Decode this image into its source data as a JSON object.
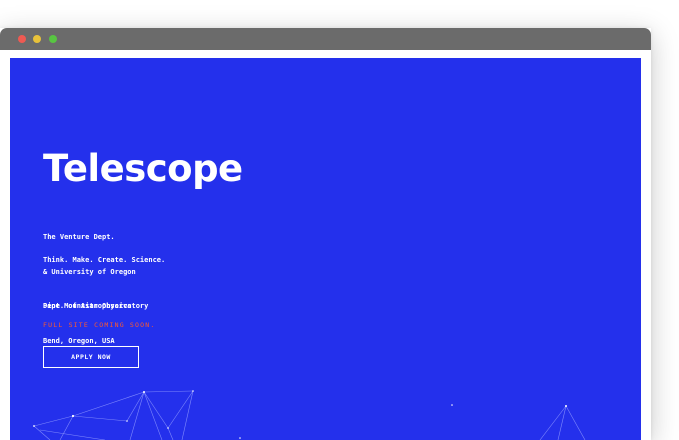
{
  "window": {
    "controls": {
      "close_color": "#ee5a52",
      "minimize_color": "#e8c23a",
      "maximize_color": "#58c542"
    }
  },
  "page": {
    "background_color": "#2430ec",
    "title": "Telescope",
    "affiliations": [
      "The Venture Dept.",
      "& University of Oregon",
      "Dept. of Astrophysics"
    ],
    "tagline": "Think. Make. Create. Science.",
    "location": [
      "Pine Mountian Observatory",
      "Bend, Oregon, USA"
    ],
    "notice": "FULL SITE COMING SOON.",
    "notice_color": "#ff5a2c",
    "apply_label": "APPLY NOW"
  }
}
